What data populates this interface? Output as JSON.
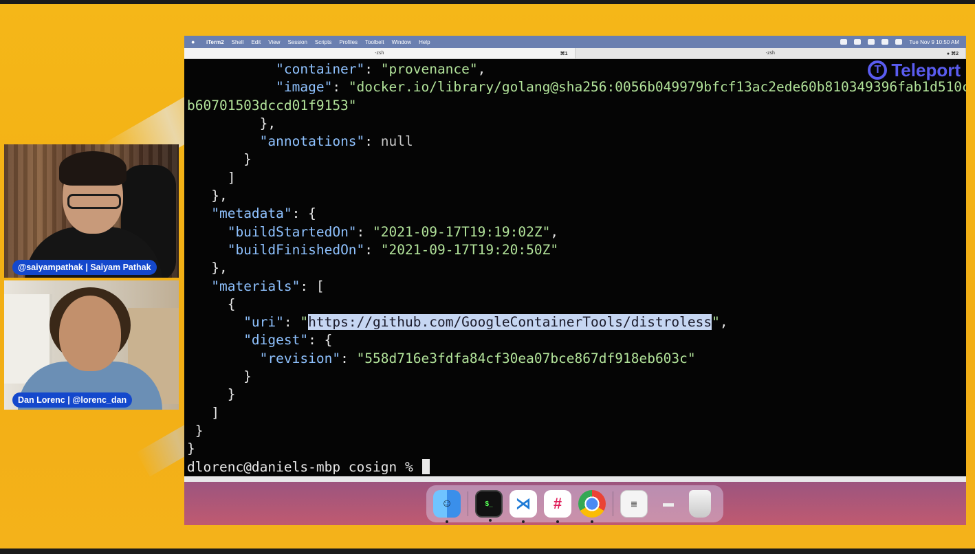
{
  "speakers": [
    {
      "name_tag": "@saiyampathak | Saiyam Pathak"
    },
    {
      "name_tag": "Dan Lorenc | @lorenc_dan"
    }
  ],
  "menubar": {
    "app": "iTerm2",
    "items": [
      "Shell",
      "Edit",
      "View",
      "Session",
      "Scripts",
      "Profiles",
      "Toolbelt",
      "Window",
      "Help"
    ],
    "clock": "Tue Nov 9  10:50 AM"
  },
  "tabs": [
    {
      "title": "-zsh",
      "shortcut": "⌘1",
      "active": true
    },
    {
      "title": "-zsh",
      "shortcut": "● ⌘2",
      "active": false
    }
  ],
  "brand": {
    "name": "Teleport",
    "color": "#5a5cf0"
  },
  "terminal": {
    "lines": [
      [
        {
          "t": "           ",
          "c": ""
        },
        {
          "t": "\"container\"",
          "c": "k"
        },
        {
          "t": ": ",
          "c": ""
        },
        {
          "t": "\"provenance\"",
          "c": "s"
        },
        {
          "t": ",",
          "c": ""
        }
      ],
      [
        {
          "t": "           ",
          "c": ""
        },
        {
          "t": "\"image\"",
          "c": "k"
        },
        {
          "t": ": ",
          "c": ""
        },
        {
          "t": "\"docker.io/library/golang@sha256:0056b049979bfcf13ac2ede60b810349396fab1d510c",
          "c": "s"
        }
      ],
      [
        {
          "t": "b60701503dccd01f9153\"",
          "c": "s"
        }
      ],
      [
        {
          "t": "         },",
          "c": ""
        }
      ],
      [
        {
          "t": "         ",
          "c": ""
        },
        {
          "t": "\"annotations\"",
          "c": "k"
        },
        {
          "t": ": ",
          "c": ""
        },
        {
          "t": "null",
          "c": "n"
        }
      ],
      [
        {
          "t": "       }",
          "c": ""
        }
      ],
      [
        {
          "t": "     ]",
          "c": ""
        }
      ],
      [
        {
          "t": "   },",
          "c": ""
        }
      ],
      [
        {
          "t": "   ",
          "c": ""
        },
        {
          "t": "\"metadata\"",
          "c": "k"
        },
        {
          "t": ": {",
          "c": ""
        }
      ],
      [
        {
          "t": "     ",
          "c": ""
        },
        {
          "t": "\"buildStartedOn\"",
          "c": "k"
        },
        {
          "t": ": ",
          "c": ""
        },
        {
          "t": "\"2021-09-17T19:19:02Z\"",
          "c": "s"
        },
        {
          "t": ",",
          "c": ""
        }
      ],
      [
        {
          "t": "     ",
          "c": ""
        },
        {
          "t": "\"buildFinishedOn\"",
          "c": "k"
        },
        {
          "t": ": ",
          "c": ""
        },
        {
          "t": "\"2021-09-17T19:20:50Z\"",
          "c": "s"
        }
      ],
      [
        {
          "t": "   },",
          "c": ""
        }
      ],
      [
        {
          "t": "   ",
          "c": ""
        },
        {
          "t": "\"materials\"",
          "c": "k"
        },
        {
          "t": ": [",
          "c": ""
        }
      ],
      [
        {
          "t": "     {",
          "c": ""
        }
      ],
      [
        {
          "t": "       ",
          "c": ""
        },
        {
          "t": "\"uri\"",
          "c": "k"
        },
        {
          "t": ": ",
          "c": ""
        },
        {
          "t": "\"",
          "c": "s"
        },
        {
          "t": "https://github.com/GoogleContainerTools/distroless",
          "c": "hl"
        },
        {
          "t": "\"",
          "c": "s"
        },
        {
          "t": ",",
          "c": ""
        }
      ],
      [
        {
          "t": "       ",
          "c": ""
        },
        {
          "t": "\"digest\"",
          "c": "k"
        },
        {
          "t": ": {",
          "c": ""
        }
      ],
      [
        {
          "t": "         ",
          "c": ""
        },
        {
          "t": "\"revision\"",
          "c": "k"
        },
        {
          "t": ": ",
          "c": ""
        },
        {
          "t": "\"558d716e3fdfa84cf30ea07bce867df918eb603c\"",
          "c": "s"
        }
      ],
      [
        {
          "t": "       }",
          "c": ""
        }
      ],
      [
        {
          "t": "     }",
          "c": ""
        }
      ],
      [
        {
          "t": "   ]",
          "c": ""
        }
      ],
      [
        {
          "t": " }",
          "c": ""
        }
      ],
      [
        {
          "t": "}",
          "c": ""
        }
      ]
    ],
    "prompt": "dlorenc@daniels-mbp cosign % "
  },
  "dock": [
    {
      "name": "finder-icon",
      "glyph": "☺"
    },
    {
      "name": "iterm-icon",
      "glyph": "$_"
    },
    {
      "name": "vscode-icon",
      "glyph": "⋊"
    },
    {
      "name": "slack-icon",
      "glyph": "#"
    },
    {
      "name": "chrome-icon",
      "glyph": ""
    },
    {
      "name": "documents-icon",
      "glyph": "≣"
    },
    {
      "name": "downloads-icon",
      "glyph": "▬"
    },
    {
      "name": "trash-icon",
      "glyph": ""
    }
  ]
}
